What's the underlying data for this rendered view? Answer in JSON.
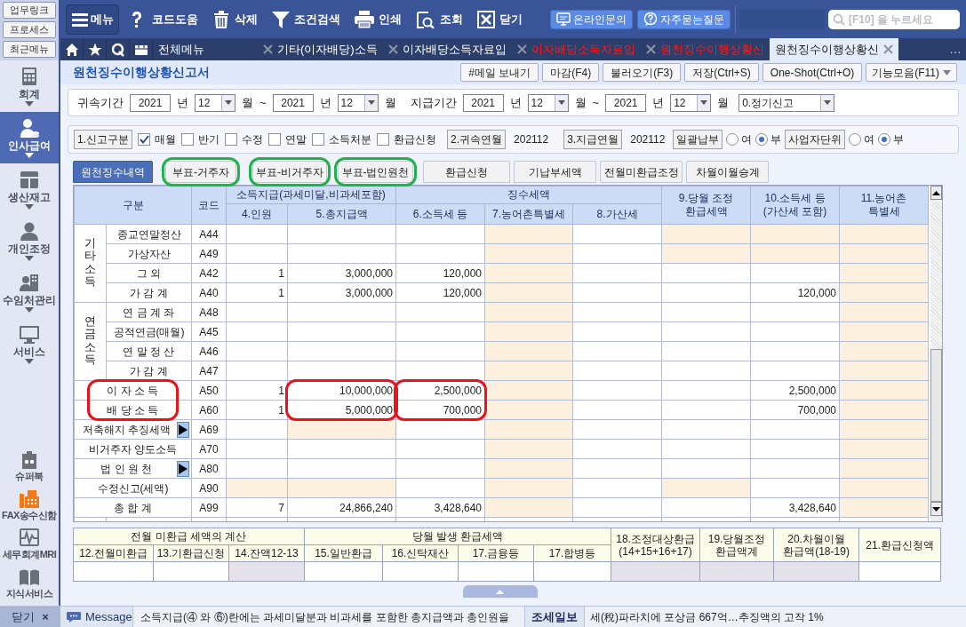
{
  "sidebar": {
    "quick_links": [
      "업무링크",
      "프로세스",
      "최근메뉴"
    ],
    "modules": [
      {
        "label": "회계",
        "kind": "calculator",
        "selected": false
      },
      {
        "label": "인사급여",
        "kind": "person",
        "selected": true
      },
      {
        "label": "생산재고",
        "kind": "grid",
        "selected": false
      },
      {
        "label": "개인조정",
        "kind": "user",
        "selected": false
      },
      {
        "label": "수임처관리",
        "kind": "office",
        "selected": false
      },
      {
        "label": "서비스",
        "kind": "monitor",
        "selected": false
      }
    ],
    "tools": [
      {
        "label": "슈퍼북",
        "kind": "badge"
      },
      {
        "label": "FAX송수신함",
        "kind": "fax"
      },
      {
        "label": "세무회계MRI",
        "kind": "pulse"
      },
      {
        "label": "지식서비스",
        "kind": "book"
      }
    ],
    "close": {
      "label": "닫기",
      "icon": "×"
    }
  },
  "toolbar": {
    "menu": "메뉴",
    "actions": [
      {
        "label": "코드도움",
        "kind": "help"
      },
      {
        "label": "삭제",
        "kind": "trash"
      },
      {
        "label": "조건검색",
        "kind": "filter"
      },
      {
        "label": "인쇄",
        "kind": "print"
      },
      {
        "label": "조회",
        "kind": "lookup"
      },
      {
        "label": "닫기",
        "kind": "close"
      }
    ],
    "links": [
      {
        "label": "온라인문의",
        "kind": "monitor"
      },
      {
        "label": "자주묻는질문",
        "kind": "question"
      }
    ],
    "search": {
      "placeholder": "[F10] 을 누르세요"
    }
  },
  "tabs": [
    {
      "label": "전체메뉴",
      "closable": false,
      "selected": false,
      "color": "#ffffff"
    },
    {
      "label": "기타(이자배당)소득",
      "closable": true,
      "selected": false,
      "color": "#ffffff"
    },
    {
      "label": "이자배당소득자료입",
      "closable": true,
      "selected": false,
      "color": "#ffffff"
    },
    {
      "label": "이자배당소득자료입",
      "closable": true,
      "selected": false,
      "color": "#ff1a1a"
    },
    {
      "label": "원천징수이행상황신",
      "closable": true,
      "selected": false,
      "color": "#ff1a1a"
    },
    {
      "label": "원천징수이행상황신",
      "closable": true,
      "selected": true,
      "color": "#1a1a1a"
    }
  ],
  "tabs_more": "…",
  "form": {
    "title": "원천징수이행상황신고서",
    "buttons": [
      "#메일 보내기",
      "마감(F4)",
      "불러오기(F3)",
      "저장(Ctrl+S)",
      "One-Shot(Ctrl+O)"
    ],
    "function_menu": "기능모음(F11)"
  },
  "periods": [
    {
      "label": "귀속기간",
      "from": {
        "year": "2021",
        "year_unit": "년",
        "month": "12",
        "month_unit": "월"
      },
      "sep": "~",
      "to": {
        "year": "2021",
        "year_unit": "년",
        "month": "12",
        "month_unit": "월"
      }
    },
    {
      "label": "지급기간",
      "from": {
        "year": "2021",
        "year_unit": "년",
        "month": "12",
        "month_unit": "월"
      },
      "sep": "~",
      "to": {
        "year": "2021",
        "year_unit": "년",
        "month": "12",
        "month_unit": "월"
      }
    }
  ],
  "report_type": "0.정기신고",
  "options": {
    "report_kind": "1.신고구분",
    "checks": [
      {
        "label": "매월",
        "checked": true
      },
      {
        "label": "반기",
        "checked": false
      },
      {
        "label": "수정",
        "checked": false
      },
      {
        "label": "연말",
        "checked": false
      },
      {
        "label": "소득처분",
        "checked": false
      },
      {
        "label": "환급신청",
        "checked": false
      }
    ],
    "months": [
      {
        "button": "2.귀속연월",
        "value": "202112"
      },
      {
        "button": "3.지급연월",
        "value": "202112"
      }
    ],
    "radios": [
      {
        "button": "일괄납부",
        "choices": [
          {
            "label": "여",
            "selected": false
          },
          {
            "label": "부",
            "selected": true
          }
        ]
      },
      {
        "button": "사업자단위",
        "choices": [
          {
            "label": "여",
            "selected": false
          },
          {
            "label": "부",
            "selected": true
          }
        ]
      }
    ]
  },
  "sub_tab_ring": {
    "color": "#22b14c"
  },
  "sub_tabs": [
    {
      "label": "원천징수내역",
      "selected": true,
      "circled": false
    },
    {
      "label": "부표-거주자",
      "selected": false,
      "circled": true
    },
    {
      "label": "부표-비거주자",
      "selected": false,
      "circled": true
    },
    {
      "label": "부표-법인원천",
      "selected": false,
      "circled": true
    },
    {
      "label": "환급신청",
      "selected": false,
      "circled": false
    },
    {
      "label": "기납부세액",
      "selected": false,
      "circled": false
    },
    {
      "label": "전월미환급조정",
      "selected": false,
      "circled": false
    },
    {
      "label": "차월이월승계",
      "selected": false,
      "circled": false
    }
  ],
  "table": {
    "ring": {
      "color": "#e8141b"
    },
    "headers": {
      "section": "구분",
      "code": "코드",
      "paid_group": "소득지급(과세미달,비과세포함)",
      "tax_group": "징수세액",
      "columns": [
        "4.인원",
        "5.총지급액",
        "6.소득세 등",
        "7.농어촌특별세",
        "8.가산세"
      ],
      "right_columns": [
        "9.당월 조정\n환급세액",
        "10.소득세 등\n(가산세 포함)",
        "11.농어촌\n특별세"
      ]
    },
    "sections": [
      {
        "category": "기타소득",
        "rows": [
          {
            "label": "종교연말정산",
            "label_circled": false,
            "code": "A44",
            "detail_button": false,
            "cells": [
              {
                "shaded": false,
                "circled": false
              },
              {
                "shaded": false,
                "circled": false
              },
              {
                "shaded": false,
                "circled": false
              },
              {
                "shaded": true,
                "circled": false
              },
              {
                "shaded": false,
                "circled": false
              },
              {
                "shaded": true,
                "circled": false
              },
              {
                "shaded": true,
                "circled": false
              },
              {
                "shaded": true,
                "circled": false
              }
            ]
          },
          {
            "label": "가상자산",
            "label_circled": false,
            "code": "A49",
            "detail_button": false,
            "cells": [
              {
                "shaded": false,
                "circled": false
              },
              {
                "shaded": false,
                "circled": false
              },
              {
                "shaded": false,
                "circled": false
              },
              {
                "shaded": true,
                "circled": false
              },
              {
                "shaded": false,
                "circled": false
              },
              {
                "shaded": true,
                "circled": false
              },
              {
                "shaded": true,
                "circled": false
              },
              {
                "shaded": true,
                "circled": false
              }
            ]
          },
          {
            "label": "그 외",
            "label_circled": false,
            "code": "A42",
            "detail_button": false,
            "cells": [
              {
                "text": "1",
                "shaded": false,
                "circled": false
              },
              {
                "text": "3,000,000",
                "shaded": false,
                "circled": false
              },
              {
                "text": "120,000",
                "shaded": false,
                "circled": false
              },
              {
                "shaded": true,
                "circled": false
              },
              {
                "shaded": false,
                "circled": false
              },
              {
                "shaded": false,
                "circled": false
              },
              {
                "shaded": false,
                "circled": false
              },
              {
                "shaded": true,
                "circled": false
              }
            ]
          },
          {
            "label": "가 감 계",
            "label_circled": false,
            "code": "A40",
            "detail_button": false,
            "cells": [
              {
                "text": "1",
                "shaded": false,
                "circled": false
              },
              {
                "text": "3,000,000",
                "shaded": false,
                "circled": false
              },
              {
                "text": "120,000",
                "shaded": false,
                "circled": false
              },
              {
                "shaded": true,
                "circled": false
              },
              {
                "shaded": false,
                "circled": false
              },
              {
                "shaded": false,
                "circled": false
              },
              {
                "text": "120,000",
                "shaded": false,
                "circled": false
              },
              {
                "shaded": true,
                "circled": false
              }
            ]
          }
        ]
      },
      {
        "category": "연금소득",
        "rows": [
          {
            "label": "연 금 계 좌",
            "label_circled": false,
            "code": "A48",
            "detail_button": false,
            "cells": [
              {
                "shaded": false,
                "circled": false
              },
              {
                "shaded": false,
                "circled": false
              },
              {
                "shaded": false,
                "circled": false
              },
              {
                "shaded": true,
                "circled": false
              },
              {
                "shaded": false,
                "circled": false
              },
              {
                "shaded": false,
                "circled": false
              },
              {
                "shaded": false,
                "circled": false
              },
              {
                "shaded": true,
                "circled": false
              }
            ]
          },
          {
            "label": "공적연금(매월)",
            "label_circled": false,
            "code": "A45",
            "detail_button": false,
            "cells": [
              {
                "shaded": false,
                "circled": false
              },
              {
                "shaded": false,
                "circled": false
              },
              {
                "shaded": false,
                "circled": false
              },
              {
                "shaded": true,
                "circled": false
              },
              {
                "shaded": false,
                "circled": false
              },
              {
                "shaded": false,
                "circled": false
              },
              {
                "shaded": false,
                "circled": false
              },
              {
                "shaded": true,
                "circled": false
              }
            ]
          },
          {
            "label": "연 말 정 산",
            "label_circled": false,
            "code": "A46",
            "detail_button": false,
            "cells": [
              {
                "shaded": false,
                "circled": false
              },
              {
                "shaded": false,
                "circled": false
              },
              {
                "shaded": false,
                "circled": false
              },
              {
                "shaded": true,
                "circled": false
              },
              {
                "shaded": false,
                "circled": false
              },
              {
                "shaded": false,
                "circled": false
              },
              {
                "shaded": false,
                "circled": false
              },
              {
                "shaded": true,
                "circled": false
              }
            ]
          },
          {
            "label": "가 감 계",
            "label_circled": false,
            "code": "A47",
            "detail_button": false,
            "cells": [
              {
                "shaded": false,
                "circled": false
              },
              {
                "shaded": false,
                "circled": false
              },
              {
                "shaded": false,
                "circled": false
              },
              {
                "shaded": true,
                "circled": false
              },
              {
                "shaded": false,
                "circled": false
              },
              {
                "shaded": false,
                "circled": false
              },
              {
                "shaded": false,
                "circled": false
              },
              {
                "shaded": true,
                "circled": false
              }
            ]
          }
        ]
      },
      {
        "rows": [
          {
            "label": "이 자 소 득",
            "label_circled": true,
            "code": "A50",
            "detail_button": false,
            "cells": [
              {
                "text": "1",
                "shaded": false,
                "circled": false
              },
              {
                "text": "10,000,000",
                "shaded": false,
                "circled": true
              },
              {
                "text": "2,500,000",
                "shaded": false,
                "circled": true
              },
              {
                "shaded": true,
                "circled": false
              },
              {
                "shaded": false,
                "circled": false
              },
              {
                "shaded": false,
                "circled": false
              },
              {
                "text": "2,500,000",
                "shaded": false,
                "circled": false
              },
              {
                "shaded": true,
                "circled": false
              }
            ]
          },
          {
            "label": "배 당 소 득",
            "label_circled": true,
            "code": "A60",
            "detail_button": false,
            "cells": [
              {
                "text": "1",
                "shaded": false,
                "circled": false
              },
              {
                "text": "5,000,000",
                "shaded": false,
                "circled": true
              },
              {
                "text": "700,000",
                "shaded": false,
                "circled": true
              },
              {
                "shaded": true,
                "circled": false
              },
              {
                "shaded": false,
                "circled": false
              },
              {
                "shaded": false,
                "circled": false
              },
              {
                "text": "700,000",
                "shaded": false,
                "circled": false
              },
              {
                "shaded": true,
                "circled": false
              }
            ]
          },
          {
            "label": "저축해지 추징세액",
            "label_circled": false,
            "code": "A69",
            "detail_button": true,
            "cells": [
              {
                "shaded": false,
                "circled": false
              },
              {
                "shaded": true,
                "circled": false
              },
              {
                "shaded": false,
                "circled": false
              },
              {
                "shaded": true,
                "circled": false
              },
              {
                "shaded": false,
                "circled": false
              },
              {
                "shaded": false,
                "circled": false
              },
              {
                "shaded": false,
                "circled": false
              },
              {
                "shaded": true,
                "circled": false
              }
            ]
          },
          {
            "label": "비거주자 양도소득",
            "label_circled": false,
            "code": "A70",
            "detail_button": false,
            "cells": [
              {
                "shaded": false,
                "circled": false
              },
              {
                "shaded": false,
                "circled": false
              },
              {
                "shaded": false,
                "circled": false
              },
              {
                "shaded": true,
                "circled": false
              },
              {
                "shaded": false,
                "circled": false
              },
              {
                "shaded": false,
                "circled": false
              },
              {
                "shaded": false,
                "circled": false
              },
              {
                "shaded": true,
                "circled": false
              }
            ]
          },
          {
            "label": "법 인 원 천",
            "label_circled": false,
            "code": "A80",
            "detail_button": true,
            "cells": [
              {
                "shaded": false,
                "circled": false
              },
              {
                "shaded": false,
                "circled": false
              },
              {
                "shaded": false,
                "circled": false
              },
              {
                "shaded": true,
                "circled": false
              },
              {
                "shaded": false,
                "circled": false
              },
              {
                "shaded": false,
                "circled": false
              },
              {
                "shaded": false,
                "circled": false
              },
              {
                "shaded": true,
                "circled": false
              }
            ]
          },
          {
            "label": "수정신고(세액)",
            "label_circled": false,
            "code": "A90",
            "detail_button": false,
            "cells": [
              {
                "shaded": true,
                "circled": false
              },
              {
                "shaded": true,
                "circled": false
              },
              {
                "shaded": false,
                "circled": false
              },
              {
                "shaded": true,
                "circled": false
              },
              {
                "shaded": false,
                "circled": false
              },
              {
                "shaded": true,
                "circled": false
              },
              {
                "shaded": false,
                "circled": false
              },
              {
                "shaded": true,
                "circled": false
              }
            ]
          },
          {
            "label": "총 합 계",
            "label_circled": false,
            "code": "A99",
            "detail_button": false,
            "cells": [
              {
                "text": "7",
                "shaded": false,
                "circled": false
              },
              {
                "text": "24,866,240",
                "shaded": false,
                "circled": false
              },
              {
                "text": "3,428,640",
                "shaded": false,
                "circled": false
              },
              {
                "shaded": true,
                "circled": false
              },
              {
                "shaded": false,
                "circled": false
              },
              {
                "shaded": false,
                "circled": false
              },
              {
                "text": "3,428,640",
                "shaded": false,
                "circled": false
              },
              {
                "shaded": true,
                "circled": false
              }
            ]
          }
        ]
      }
    ]
  },
  "refund": {
    "groups": [
      {
        "label": "전월 미환급 세액의 계산",
        "columns": [
          {
            "label": "12.전월미환급",
            "shaded": false
          },
          {
            "label": "13.기환급신청",
            "shaded": false
          },
          {
            "label": "14.잔액12-13",
            "shaded": true
          }
        ]
      },
      {
        "label": "당월 발생 환급세액",
        "columns": [
          {
            "label": "15.일반환급",
            "shaded": false
          },
          {
            "label": "16.신탁재산",
            "shaded": false
          },
          {
            "label": "17.금융등",
            "shaded": false
          },
          {
            "label": "17.합병등",
            "shaded": false
          }
        ]
      }
    ],
    "totals": [
      {
        "label": "18.조정대상환급\n(14+15+16+17)",
        "shaded": true
      },
      {
        "label": "19.당월조정\n환급액계",
        "shaded": true
      },
      {
        "label": "20.차월이월\n환급액(18-19)",
        "shaded": true
      },
      {
        "label": "21.환급신청액",
        "shaded": false
      }
    ]
  },
  "status_bar": {
    "message_label": "Message",
    "message": "소득지급(④ 와 ⑥)란에는 과세미달분과 비과세를 포함한 총지급액과 총인원을",
    "news_source": "조세일보",
    "news": "세(稅)파라치에 포상금 667억…추징액의 고작 1%"
  }
}
